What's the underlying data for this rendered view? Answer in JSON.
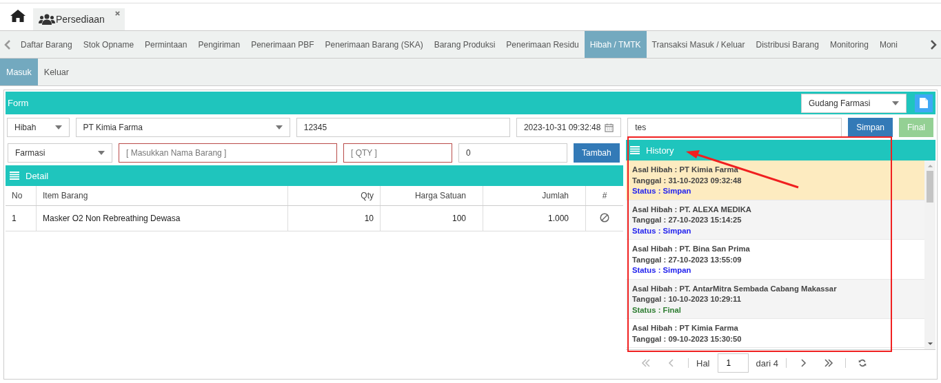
{
  "top_tabs": [
    {
      "label": "Persediaan",
      "selected": true
    }
  ],
  "menu": {
    "items": [
      {
        "label": "Daftar Barang",
        "selected": false
      },
      {
        "label": "Stok Opname",
        "selected": false
      },
      {
        "label": "Permintaan",
        "selected": false
      },
      {
        "label": "Pengiriman",
        "selected": false
      },
      {
        "label": "Penerimaan PBF",
        "selected": false
      },
      {
        "label": "Penerimaan Barang (SKA)",
        "selected": false
      },
      {
        "label": "Barang Produksi",
        "selected": false
      },
      {
        "label": "Penerimaan Residu",
        "selected": false
      },
      {
        "label": "Hibah / TMTK",
        "selected": true
      },
      {
        "label": "Transaksi Masuk / Keluar",
        "selected": false
      },
      {
        "label": "Distribusi Barang",
        "selected": false
      },
      {
        "label": "Monitoring",
        "selected": false
      },
      {
        "label": "Moni",
        "selected": false
      }
    ]
  },
  "subtabs": [
    {
      "label": "Masuk",
      "selected": true
    },
    {
      "label": "Keluar",
      "selected": false
    }
  ],
  "form": {
    "title": "Form",
    "warehouse": "Gudang Farmasi",
    "type": "Hibah",
    "source": "PT Kimia Farma",
    "number": "12345",
    "date": "2023-10-31 09:32:48",
    "note": "tes",
    "buttons": [
      {
        "label": "Simpan",
        "kind": "save",
        "disabled": false
      },
      {
        "label": "Final",
        "kind": "final",
        "disabled": true
      }
    ]
  },
  "item_entry": {
    "category": "Farmasi",
    "name_placeholder": "[ Masukkan Nama Barang ]",
    "qty_placeholder": "[ QTY ]",
    "price": "0",
    "add_button": "Tambah"
  },
  "detail": {
    "title": "Detail",
    "columns": [
      "No",
      "Item Barang",
      "Qty",
      "Harga Satuan",
      "Jumlah",
      "#"
    ],
    "rows": [
      {
        "no": "1",
        "item": "Masker O2 Non Rebreathing Dewasa",
        "qty": "10",
        "price": "100",
        "total": "1.000"
      }
    ]
  },
  "history": {
    "title": "History",
    "items": [
      {
        "source": "Asal Hibah : PT Kimia Farma",
        "date": "Tanggal : 31-10-2023 09:32:48",
        "status": "Status : Simpan",
        "kind": "simpan",
        "selected": true
      },
      {
        "source": "Asal Hibah : PT. ALEXA MEDIKA",
        "date": "Tanggal : 27-10-2023 15:14:25",
        "status": "Status : Simpan",
        "kind": "simpan",
        "selected": false
      },
      {
        "source": "Asal Hibah : PT. Bina San Prima",
        "date": "Tanggal : 27-10-2023 13:55:09",
        "status": "Status : Simpan",
        "kind": "simpan",
        "selected": false
      },
      {
        "source": "Asal Hibah : PT. AntarMitra Sembada Cabang Makassar",
        "date": "Tanggal : 10-10-2023 10:29:11",
        "status": "Status : Final",
        "kind": "final",
        "selected": false
      },
      {
        "source": "Asal Hibah : PT Kimia Farma",
        "date": "Tanggal : 09-10-2023 15:30:50",
        "selected": false
      }
    ],
    "pager": {
      "label": "Hal",
      "page": "1",
      "of": "dari 4"
    }
  }
}
